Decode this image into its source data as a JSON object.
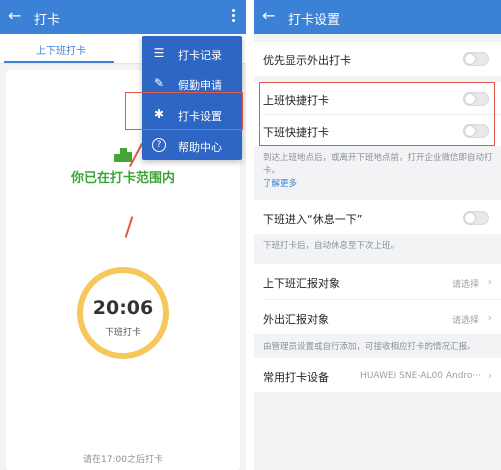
{
  "left": {
    "title": "打卡",
    "tab": "上下班打卡",
    "range_text": "你已在打卡范围内",
    "clock": {
      "time": "20:06",
      "label": "下班打卡"
    },
    "bottom_hint": "请在17:00之后打卡",
    "menu": [
      {
        "label": "打卡记录",
        "icon": "list-icon"
      },
      {
        "label": "假勤申请",
        "icon": "edit-icon"
      },
      {
        "label": "打卡设置",
        "icon": "gear-icon"
      },
      {
        "label": "帮助中心",
        "icon": "help-icon"
      }
    ]
  },
  "right": {
    "title": "打卡设置",
    "rows": {
      "outside_first": "优先显示外出打卡",
      "quick_on": "上班快捷打卡",
      "quick_off": "下班快捷打卡",
      "quick_desc": "到达上班地点后，或离开下班地点前，打开企业微信即自动打卡。",
      "learn_more": "了解更多",
      "rest_mode": "下班进入“休息一下”",
      "rest_desc": "下班打卡后，自动休息至下次上班。",
      "report_commute": "上下班汇报对象",
      "report_out": "外出汇报对象",
      "choose": "请选择",
      "report_desc": "由管理员设置或自行添加，可接收相应打卡的情况汇报。",
      "device": "常用打卡设备",
      "device_value": "HUAWEI SNE-AL00 Andro···"
    }
  },
  "colors": {
    "primary": "#3b82d6",
    "menu": "#2d66c4",
    "green": "#39a534",
    "ring": "#f6c75a",
    "highlight": "#e05a4a"
  }
}
